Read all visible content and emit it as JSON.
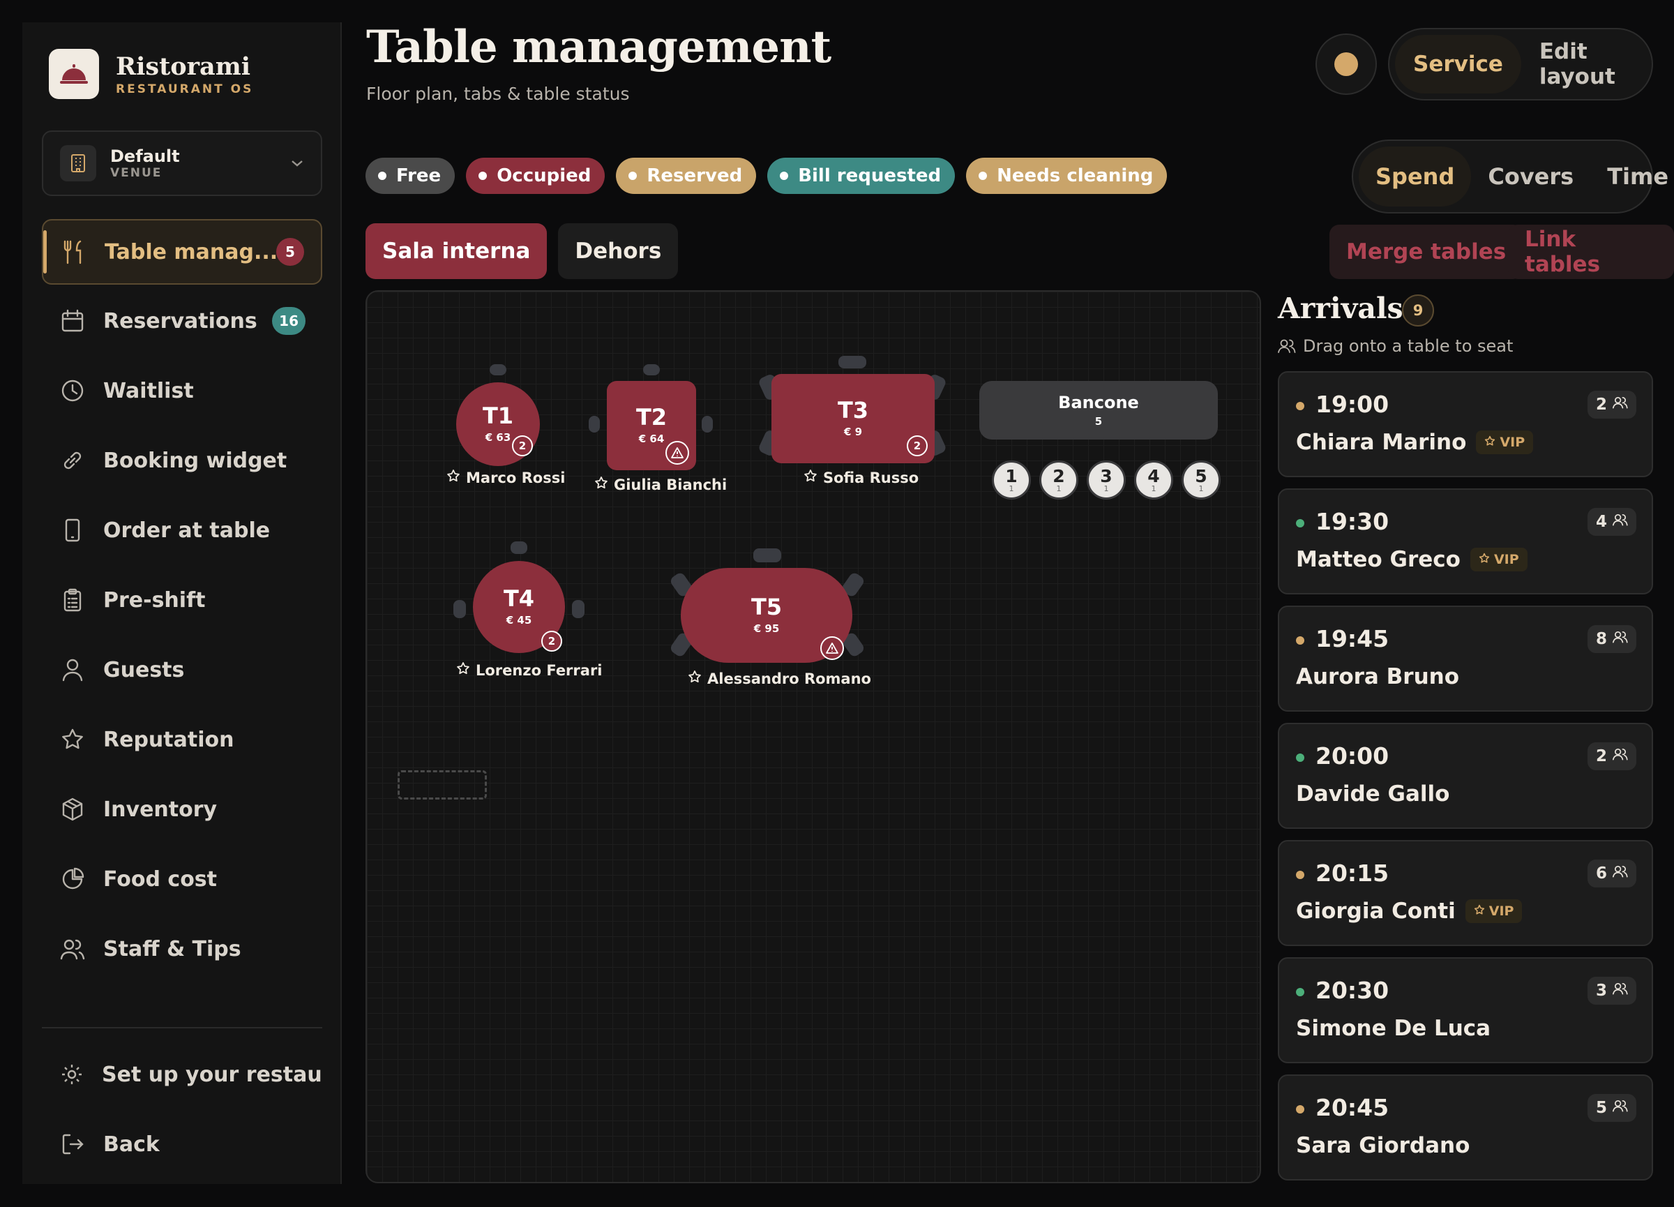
{
  "brand": {
    "name": "Ristorami",
    "subtitle": "RESTAURANT OS"
  },
  "venue": {
    "name": "Default",
    "label": "VENUE"
  },
  "sidebar": {
    "items": [
      {
        "label": "Table manag...",
        "icon": "utensils-icon",
        "badge": "5",
        "active": true
      },
      {
        "label": "Reservations",
        "icon": "calendar-icon",
        "badge": "16"
      },
      {
        "label": "Waitlist",
        "icon": "clock-icon"
      },
      {
        "label": "Booking widget",
        "icon": "link-icon"
      },
      {
        "label": "Order at table",
        "icon": "tablet-icon"
      },
      {
        "label": "Pre-shift",
        "icon": "clipboard-icon"
      },
      {
        "label": "Guests",
        "icon": "user-icon"
      },
      {
        "label": "Reputation",
        "icon": "star-icon"
      },
      {
        "label": "Inventory",
        "icon": "box-icon"
      },
      {
        "label": "Food cost",
        "icon": "pie-chart-icon"
      },
      {
        "label": "Staff & Tips",
        "icon": "users-icon"
      }
    ],
    "bottom": [
      {
        "label": "Set up your restau...",
        "icon": "gear-icon"
      },
      {
        "label": "Back",
        "icon": "logout-icon"
      }
    ]
  },
  "header": {
    "title": "Table management",
    "subtitle": "Floor plan, tabs & table status",
    "mode": {
      "service": "Service",
      "edit": "Edit layout"
    }
  },
  "legend": [
    {
      "label": "Free",
      "color": "#4a4a4a"
    },
    {
      "label": "Occupied",
      "color": "#8c2f3c"
    },
    {
      "label": "Reserved",
      "color": "#c9a46a"
    },
    {
      "label": "Bill requested",
      "color": "#3d8a84"
    },
    {
      "label": "Needs cleaning",
      "color": "#c9a46a"
    }
  ],
  "metric": {
    "spend": "Spend",
    "covers": "Covers",
    "time": "Time"
  },
  "rooms": {
    "sala": "Sala interna",
    "dehors": "Dehors"
  },
  "actions": {
    "merge": "Merge tables",
    "link": "Link tables"
  },
  "tables": [
    {
      "name": "T1",
      "spend": "€ 63",
      "guests": "2",
      "guest_name": "Marco Rossi"
    },
    {
      "name": "T2",
      "spend": "€ 64",
      "guest_name": "Giulia Bianchi"
    },
    {
      "name": "T3",
      "spend": "€ 9",
      "guests": "2",
      "guest_name": "Sofia Russo"
    },
    {
      "name": "T4",
      "spend": "€ 45",
      "guests": "2",
      "guest_name": "Lorenzo Ferrari"
    },
    {
      "name": "T5",
      "spend": "€ 95",
      "guest_name": "Alessandro Romano"
    }
  ],
  "bar": {
    "name": "Bancone",
    "seats": "5",
    "stools": [
      "1",
      "2",
      "3",
      "4",
      "5"
    ],
    "stool_seats": "1"
  },
  "arrivals": {
    "title": "Arrivals",
    "count": "9",
    "hint": "Drag onto a table to seat",
    "items": [
      {
        "time": "19:00",
        "name": "Chiara Marino",
        "party": "2",
        "vip": "VIP",
        "dot": "#d4a86a"
      },
      {
        "time": "19:30",
        "name": "Matteo Greco",
        "party": "4",
        "vip": "VIP",
        "dot": "#4caf7a"
      },
      {
        "time": "19:45",
        "name": "Aurora Bruno",
        "party": "8",
        "dot": "#d4a86a"
      },
      {
        "time": "20:00",
        "name": "Davide Gallo",
        "party": "2",
        "dot": "#4caf7a"
      },
      {
        "time": "20:15",
        "name": "Giorgia Conti",
        "party": "6",
        "vip": "VIP",
        "dot": "#d4a86a"
      },
      {
        "time": "20:30",
        "name": "Simone De Luca",
        "party": "3",
        "dot": "#4caf7a"
      },
      {
        "time": "20:45",
        "name": "Sara Giordano",
        "party": "5",
        "dot": "#d4a86a"
      }
    ]
  }
}
